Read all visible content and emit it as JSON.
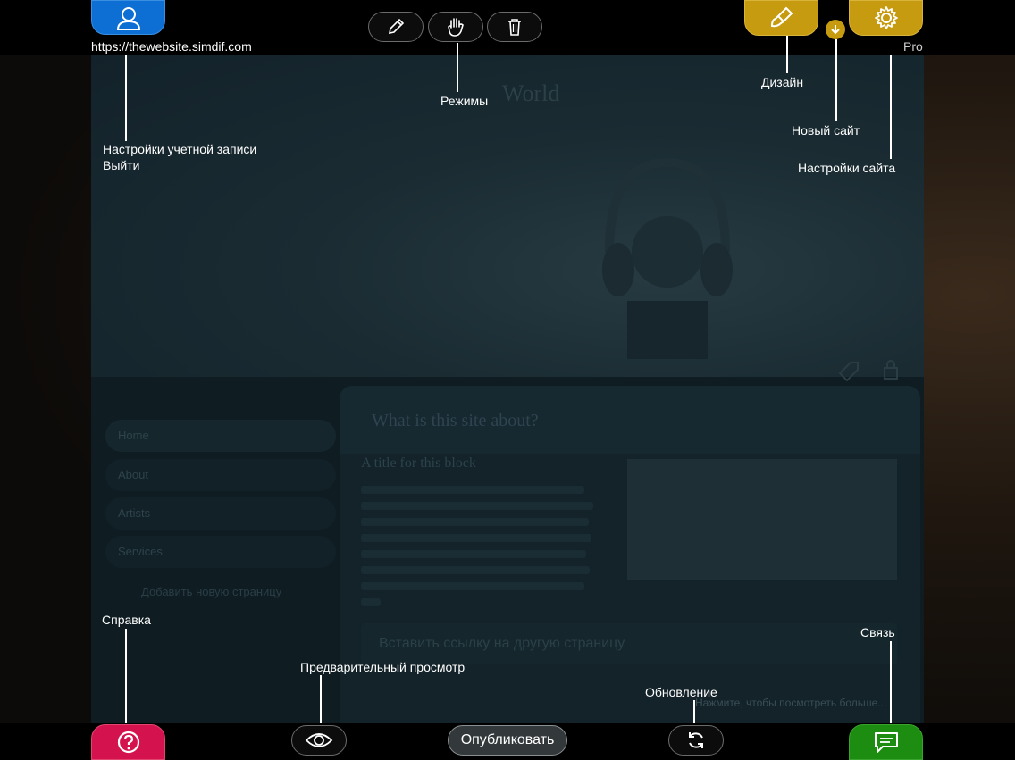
{
  "site": {
    "title": "World",
    "nav_items": [
      "Home",
      "About",
      "Artists",
      "Services"
    ],
    "nav_add": "Добавить новую страницу",
    "card_title": "What is this site about?",
    "block_title": "A title for this block",
    "link_text": "Вставить ссылку на другую страницу",
    "more_text": "Нажмите, чтобы посмотреть больше..."
  },
  "top": {
    "url": "https://thewebsite.simdif.com",
    "pro": "Pro"
  },
  "bottom": {
    "publish_label": "Опубликовать"
  },
  "callouts": {
    "modes": "Режимы",
    "design": "Дизайн",
    "new_site": "Новый сайт",
    "site_settings": "Настройки сайта",
    "account_settings": "Настройки учетной записи",
    "logout": "Выйти",
    "help": "Справка",
    "preview": "Предварительный просмотр",
    "refresh": "Обновление",
    "contact": "Связь"
  },
  "colors": {
    "account": "#0d6fd4",
    "design": "#c69b10",
    "help": "#d4134e",
    "chat": "#1d8d12"
  },
  "icons": {
    "account": "user-icon",
    "edit": "pencil-icon",
    "move": "hand-icon",
    "trash": "trash-icon",
    "design": "brush-icon",
    "new_site": "arrow-down-circle-icon",
    "settings": "gear-icon",
    "help": "question-icon",
    "preview": "eye-icon",
    "refresh": "refresh-icon",
    "chat": "chat-bubble-icon"
  }
}
